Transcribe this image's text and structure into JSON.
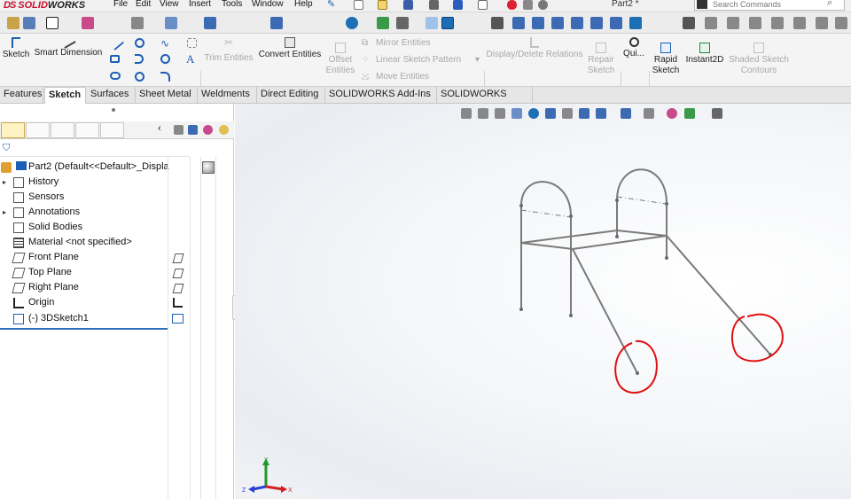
{
  "app": {
    "logo_ds": "DS",
    "logo_solid": "SOLID",
    "logo_works": "WORKS"
  },
  "menu": {
    "items": [
      "File",
      "Edit",
      "View",
      "Insert",
      "Tools",
      "Window",
      "Help"
    ],
    "document_title": "Part2 *",
    "search_placeholder": "Search Commands"
  },
  "command_manager": {
    "sketch": "Sketch",
    "smart_dimension": "Smart Dimension",
    "trim_entities": "Trim Entities",
    "convert_entities": "Convert Entities",
    "offset_entities_1": "Offset",
    "offset_entities_2": "Entities",
    "mirror_entities": "Mirror Entities",
    "linear_sketch_pattern": "Linear Sketch Pattern",
    "move_entities": "Move Entities",
    "display_delete_relations": "Display/Delete Relations",
    "repair_sketch_1": "Repair",
    "repair_sketch_2": "Sketch",
    "quick_snaps": "Qui...",
    "rapid_sketch_1": "Rapid",
    "rapid_sketch_2": "Sketch",
    "instant2d": "Instant2D",
    "shaded_sketch_1": "Shaded Sketch",
    "shaded_sketch_2": "Contours"
  },
  "tabs": [
    "Features",
    "Sketch",
    "Surfaces",
    "Sheet Metal",
    "Weldments",
    "Direct Editing",
    "SOLIDWORKS Add-Ins",
    "SOLIDWORKS MBD"
  ],
  "active_tab": "Sketch",
  "feature_tree": {
    "root": "Part2  (Default<<Default>_Displa",
    "items": [
      {
        "label": "History",
        "expandable": true,
        "icon": "history-icon"
      },
      {
        "label": "Sensors",
        "expandable": false,
        "icon": "sensors-icon"
      },
      {
        "label": "Annotations",
        "expandable": true,
        "icon": "annotations-icon"
      },
      {
        "label": "Solid Bodies",
        "expandable": false,
        "icon": "solid-bodies-icon"
      },
      {
        "label": "Material <not specified>",
        "expandable": false,
        "icon": "material-icon"
      },
      {
        "label": "Front Plane",
        "expandable": false,
        "icon": "plane-icon"
      },
      {
        "label": "Top Plane",
        "expandable": false,
        "icon": "plane-icon"
      },
      {
        "label": "Right Plane",
        "expandable": false,
        "icon": "plane-icon"
      },
      {
        "label": "Origin",
        "expandable": false,
        "icon": "origin-icon"
      },
      {
        "label": "(-) 3DSketch1",
        "expandable": false,
        "icon": "3dsketch-icon"
      }
    ]
  },
  "triad": {
    "x": "X",
    "y": "Y",
    "z": "Z"
  },
  "colors": {
    "brand_red": "#c8102e",
    "selection_blue": "#2e6fc0",
    "sketch_line": "#7a7a7a",
    "annotation_red": "#e01010",
    "axis_x": "#d42020",
    "axis_y": "#1f9a2a",
    "axis_z": "#2a3fd0"
  }
}
